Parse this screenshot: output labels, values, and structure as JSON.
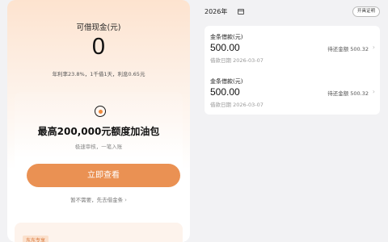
{
  "left": {
    "credit": {
      "label": "可借现金(元)",
      "amount": "0",
      "rate_text": "年利率23.8%，1千借1天，利息0.65元"
    },
    "promo": {
      "icon": "coin-icon",
      "title": "最高200,000元额度加油包",
      "subtitle": "极速审核，一笔入账",
      "cta_label": "立即查看",
      "secondary_link": "暂不需要，先去借金条",
      "chevron": "›"
    },
    "bottom_tag": "东东专享"
  },
  "right": {
    "year_label": "2026年",
    "calendar_icon": "calendar-icon",
    "cert_button": "开具证明",
    "loans": [
      {
        "title": "金条借款(元)",
        "amount": "500.00",
        "date": "借款日期 2026-03-07",
        "due": "待还金额 500.32",
        "chevron": "›"
      },
      {
        "title": "金条借款(元)",
        "amount": "500.00",
        "date": "借款日期 2026-03-07",
        "due": "待还金额 500.32",
        "chevron": "›"
      }
    ]
  },
  "colors": {
    "accent": "#ea9153",
    "background": "#f2f2f4",
    "header_gradient_top": "#fde3cf"
  }
}
